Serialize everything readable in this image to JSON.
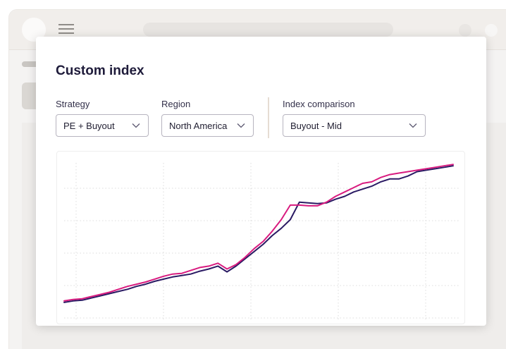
{
  "modal": {
    "title": "Custom index"
  },
  "filters": {
    "strategy": {
      "label": "Strategy",
      "value": "PE + Buyout"
    },
    "region": {
      "label": "Region",
      "value": "North America"
    },
    "index_comparison": {
      "label": "Index comparison",
      "value": "Buyout - Mid"
    }
  },
  "icons": {
    "menu": "hamburger-icon",
    "select_arrow": "chevron-down-icon"
  },
  "colors": {
    "series_custom": "#d81b7f",
    "series_index": "#2a1a63",
    "title": "#1e1b3a"
  },
  "chart_data": {
    "type": "line",
    "xlabel": "",
    "ylabel": "",
    "grid": true,
    "xlim": [
      0,
      43
    ],
    "ylim": [
      0,
      100
    ],
    "x": [
      0,
      1,
      2,
      3,
      4,
      5,
      6,
      7,
      8,
      9,
      10,
      11,
      12,
      13,
      14,
      15,
      16,
      17,
      18,
      19,
      20,
      21,
      22,
      23,
      24,
      25,
      26,
      27,
      28,
      29,
      30,
      31,
      32,
      33,
      34,
      35,
      36,
      37,
      38,
      39,
      40,
      41,
      42,
      43
    ],
    "series": [
      {
        "values": [
          2,
          3,
          3.5,
          5,
          6.5,
          8,
          9.5,
          11,
          13,
          14.5,
          16.5,
          18,
          19.5,
          20.5,
          21.5,
          23.5,
          25,
          27,
          23,
          27,
          32,
          37,
          42,
          48,
          53,
          59,
          71,
          70.5,
          70,
          70.5,
          73,
          75,
          78,
          80,
          82,
          85,
          87,
          87,
          89,
          92,
          93,
          94,
          95,
          96
        ]
      },
      {
        "values": [
          3,
          4,
          4.5,
          6,
          7.5,
          9,
          11,
          13,
          14.5,
          16,
          18,
          20,
          21.5,
          22,
          24,
          26,
          27,
          29,
          25,
          28,
          33,
          39,
          44,
          51,
          59,
          69,
          69,
          68.5,
          68.5,
          71,
          75,
          78,
          81,
          84,
          85,
          88,
          90,
          91,
          92,
          93,
          94,
          95,
          96,
          97
        ]
      }
    ]
  }
}
